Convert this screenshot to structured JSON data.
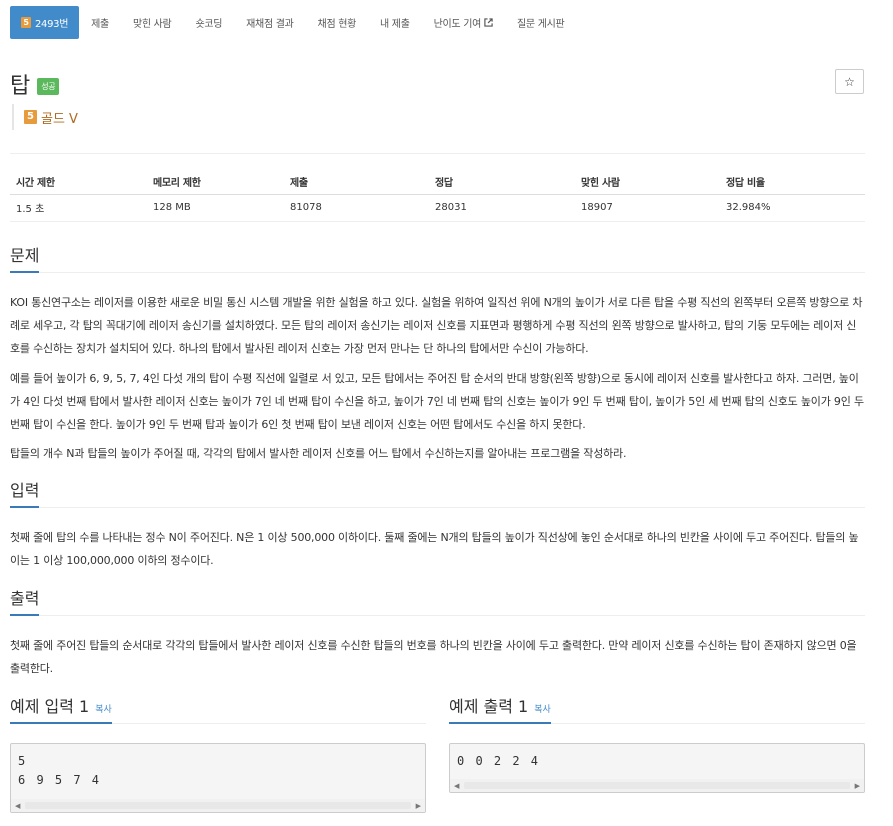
{
  "tabs": {
    "problem_tier": "5",
    "problem_number": "2493번",
    "submit": "제출",
    "solved_users": "맞힌 사람",
    "shortest_code": "숏코딩",
    "rejudge_result": "재채점 결과",
    "rejudge_status": "채점 현황",
    "my_submissions": "내 제출",
    "difficulty_contribute": "난이도 기여",
    "qna_board": "질문 게시판"
  },
  "problem": {
    "title": "탑",
    "result_label": "성공",
    "star_label": "☆",
    "tier_number": "5",
    "tier_name": "골드 V"
  },
  "info_table": {
    "headers": [
      "시간 제한",
      "메모리 제한",
      "제출",
      "정답",
      "맞힌 사람",
      "정답 비율"
    ],
    "values": [
      "1.5 초",
      "128 MB",
      "81078",
      "28031",
      "18907",
      "32.984%"
    ]
  },
  "sections": {
    "description": {
      "heading": "문제",
      "paragraphs": [
        "KOI 통신연구소는 레이저를 이용한 새로운 비밀 통신 시스템 개발을 위한 실험을 하고 있다. 실험을 위하여 일직선 위에 N개의 높이가 서로 다른 탑을 수평 직선의 왼쪽부터 오른쪽 방향으로 차례로 세우고, 각 탑의 꼭대기에 레이저 송신기를 설치하였다. 모든 탑의 레이저 송신기는 레이저 신호를 지표면과 평행하게 수평 직선의 왼쪽 방향으로 발사하고, 탑의 기둥 모두에는 레이저 신호를 수신하는 장치가 설치되어 있다. 하나의 탑에서 발사된 레이저 신호는 가장 먼저 만나는 단 하나의 탑에서만 수신이 가능하다.",
        "예를 들어 높이가 6, 9, 5, 7, 4인 다섯 개의 탑이 수평 직선에 일렬로 서 있고, 모든 탑에서는 주어진 탑 순서의 반대 방향(왼쪽 방향)으로 동시에 레이저 신호를 발사한다고 하자. 그러면, 높이가 4인 다섯 번째 탑에서 발사한 레이저 신호는 높이가 7인 네 번째 탑이 수신을 하고, 높이가 7인 네 번째 탑의 신호는 높이가 9인 두 번째 탑이, 높이가 5인 세 번째 탑의 신호도 높이가 9인 두 번째 탑이 수신을 한다. 높이가 9인 두 번째 탑과 높이가 6인 첫 번째 탑이 보낸 레이저 신호는 어떤 탑에서도 수신을 하지 못한다.",
        "탑들의 개수 N과 탑들의 높이가 주어질 때, 각각의 탑에서 발사한 레이저 신호를 어느 탑에서 수신하는지를 알아내는 프로그램을 작성하라."
      ]
    },
    "input": {
      "heading": "입력",
      "text": "첫째 줄에 탑의 수를 나타내는 정수 N이 주어진다. N은 1 이상 500,000 이하이다. 둘째 줄에는 N개의 탑들의 높이가 직선상에 놓인 순서대로 하나의 빈칸을 사이에 두고 주어진다. 탑들의 높이는 1 이상 100,000,000 이하의 정수이다."
    },
    "output": {
      "heading": "출력",
      "text": "첫째 줄에 주어진 탑들의 순서대로 각각의 탑들에서 발사한 레이저 신호를 수신한 탑들의 번호를 하나의 빈칸을 사이에 두고 출력한다. 만약 레이저 신호를 수신하는 탑이 존재하지 않으면 0을 출력한다."
    }
  },
  "samples": {
    "input": {
      "heading": "예제 입력 1",
      "copy_label": "복사",
      "content": "5\n6 9 5 7 4"
    },
    "output": {
      "heading": "예제 출력 1",
      "copy_label": "복사",
      "content": "0 0 2 2 4"
    }
  },
  "scrollbar": {
    "left_arrow": "◀",
    "right_arrow": "▶"
  },
  "colors": {
    "active_tab": "#428bca",
    "success_label": "#5cb85c",
    "tier_gold": "#e89b3c",
    "tier_text": "#ad6b21",
    "section_underline": "#3a7ab8"
  }
}
